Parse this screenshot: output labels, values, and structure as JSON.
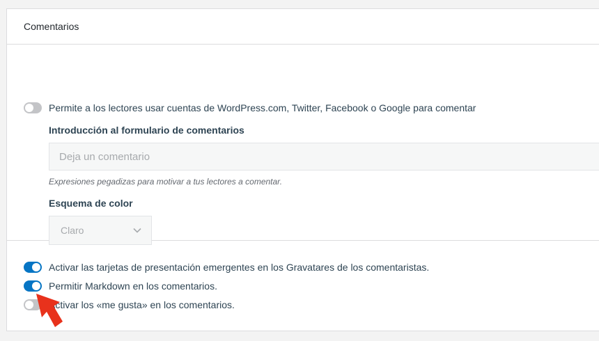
{
  "card": {
    "title": "Comentarios"
  },
  "social_login": {
    "label": "Permite a los lectores usar cuentas de WordPress.com, Twitter, Facebook o Google para comentar",
    "enabled": false
  },
  "comment_intro": {
    "label": "Introducción al formulario de comentarios",
    "placeholder": "Deja un comentario",
    "help": "Expresiones pegadizas para motivar a tus lectores a comentar."
  },
  "color_scheme": {
    "label": "Esquema de color",
    "selected": "Claro"
  },
  "toggles": [
    {
      "label": "Activar las tarjetas de presentación emergentes en los Gravatares de los comentaristas.",
      "enabled": true
    },
    {
      "label": "Permitir Markdown en los comentarios.",
      "enabled": true
    },
    {
      "label": "Activar los «me gusta» en los comentarios.",
      "enabled": false
    }
  ],
  "colors": {
    "toggle_on": "#0675c4",
    "toggle_off": "#c3c4c7",
    "annotation_arrow": "#e8321c"
  },
  "icons": {
    "select_chevron": "chevron-down-icon",
    "annotation": "arrow-pointer-icon"
  }
}
